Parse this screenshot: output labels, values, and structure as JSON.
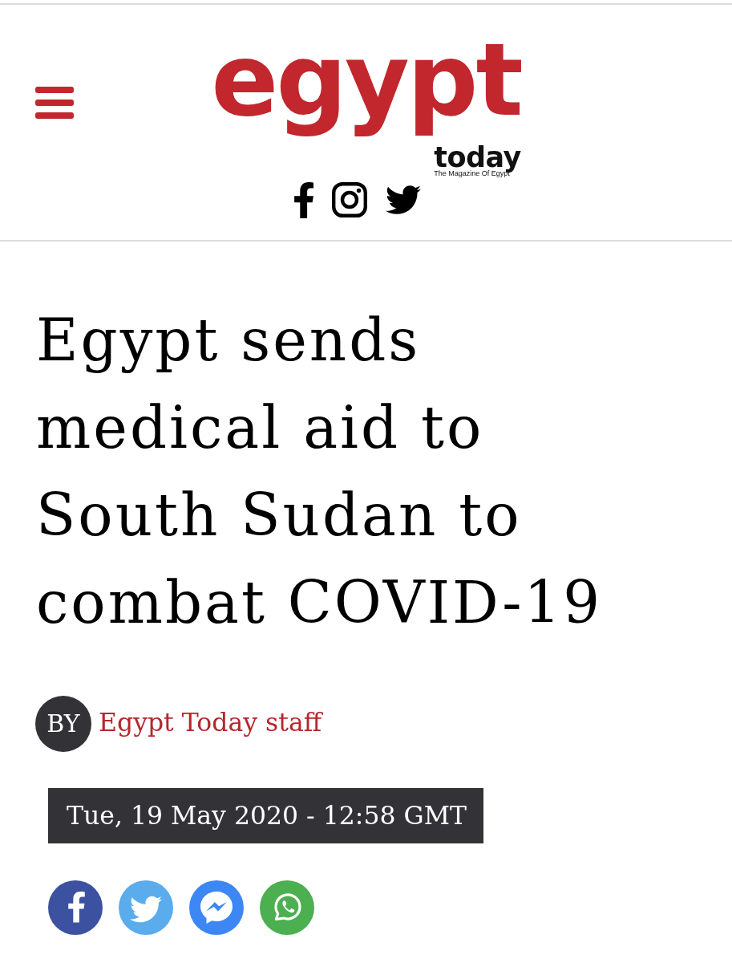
{
  "header": {
    "logo": {
      "wordmark": "egypt",
      "subword": "today",
      "tagline": "The Magazine Of Egypt"
    }
  },
  "article": {
    "headline": "Egypt sends medical aid to South Sudan to combat COVID-19",
    "byline": {
      "prefix": "BY",
      "author": "Egypt Today staff"
    },
    "date": "Tue, 19 May 2020 - 12:58 GMT"
  }
}
